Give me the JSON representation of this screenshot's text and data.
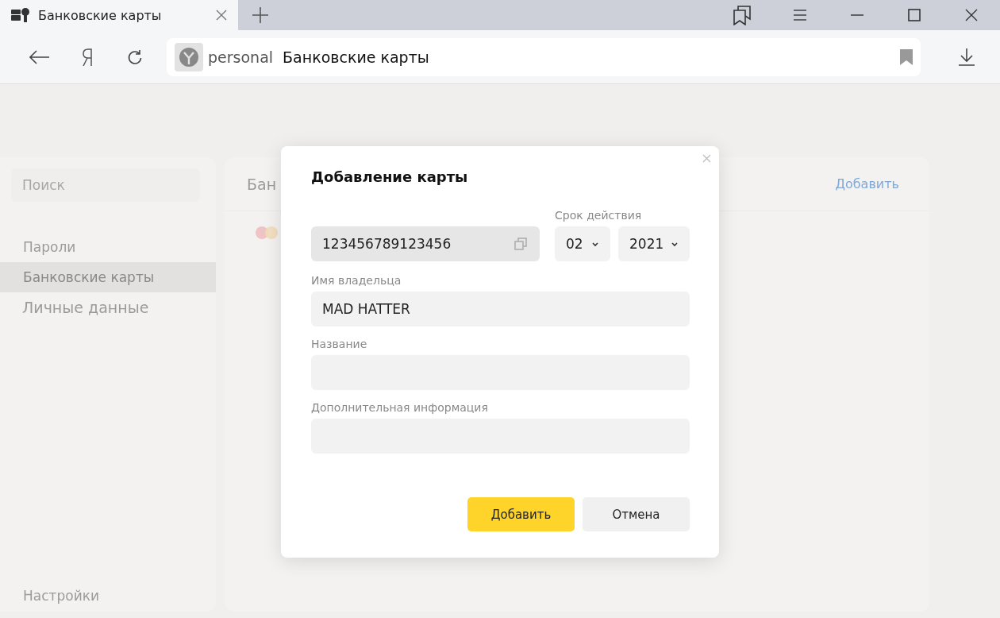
{
  "tab": {
    "title": "Банковские карты",
    "selected": true
  },
  "address": {
    "host": "personal",
    "title": "Банковские карты"
  },
  "sidebar": {
    "search": {
      "placeholder": "Поиск"
    },
    "items": [
      {
        "label": "Пароли",
        "selected": false
      },
      {
        "label": "Банковские карты",
        "selected": true
      }
    ],
    "section": "Личные данные",
    "footer": "Настройки"
  },
  "main": {
    "heading": "Бан",
    "add_link": "Добавить"
  },
  "dialog": {
    "title": "Добавление карты",
    "card_number": {
      "value": "123456789123456"
    },
    "expiry": {
      "label": "Срок действия",
      "month": "02",
      "year": "2021"
    },
    "fields": [
      {
        "label": "Имя владельца",
        "value": "MAD HATTER"
      },
      {
        "label": "Название"
      },
      {
        "label": "Дополнительная информация"
      }
    ],
    "buttons": [
      {
        "label": "Добавить",
        "kind": "primary"
      },
      {
        "label": "Отмена",
        "kind": "secondary"
      }
    ]
  }
}
